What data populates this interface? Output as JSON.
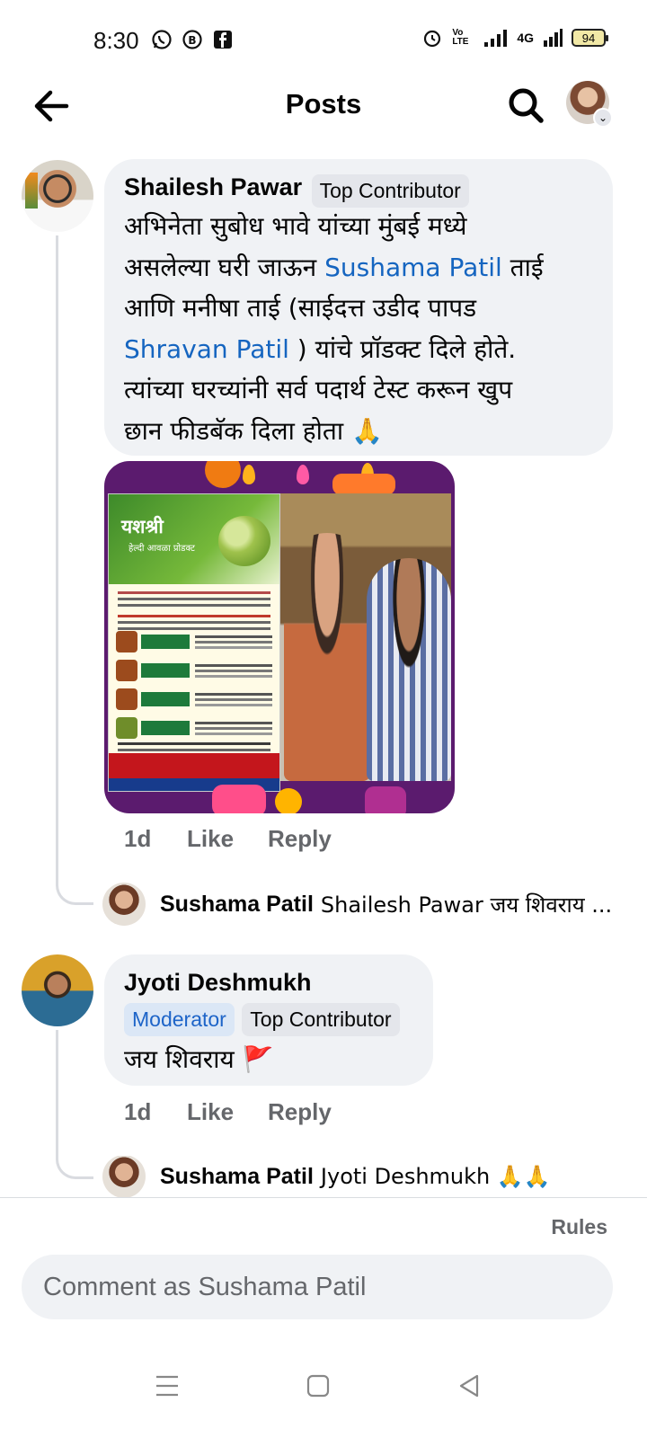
{
  "status_bar": {
    "time": "8:30",
    "network": "4G",
    "volte": "Vo LTE",
    "battery": "94"
  },
  "header": {
    "title": "Posts"
  },
  "comments": [
    {
      "author": "Shailesh Pawar",
      "badges": [
        "Top Contributor"
      ],
      "lines": [
        {
          "segments": [
            {
              "t": "अभिनेता सुबोध भावे यांच्या मुंबई मध्ये"
            }
          ]
        },
        {
          "segments": [
            {
              "t": "असलेल्या घरी जाऊन "
            },
            {
              "t": "Sushama Patil",
              "mention": true
            },
            {
              "t": " ताई"
            }
          ]
        },
        {
          "segments": [
            {
              "t": "आणि मनीषा ताई (साईदत्त उडीद पापड"
            }
          ]
        },
        {
          "segments": [
            {
              "t": "Shravan Patil",
              "mention": true
            },
            {
              "t": " ) यांचे प्रॉडक्ट दिले होते."
            }
          ]
        },
        {
          "segments": [
            {
              "t": "त्यांच्या घरच्यांनी सर्व पदार्थ टेस्ट करून खुप"
            }
          ]
        },
        {
          "segments": [
            {
              "t": "छान फीडबॅक दिला होता 🙏"
            }
          ]
        }
      ],
      "time": "1d",
      "like": "Like",
      "reply": "Reply",
      "image": {
        "flyer_title": "यशश्री",
        "flyer_subtitle": "हेल्दी आवळा प्रोडक्ट"
      },
      "reply_preview": {
        "author": "Sushama Patil",
        "text": "Shailesh Pawar जय शिवराय  ..."
      }
    },
    {
      "author": "Jyoti Deshmukh",
      "badges": [
        "Moderator",
        "Top Contributor"
      ],
      "text": "जय शिवराय 🚩",
      "time": "1d",
      "like": "Like",
      "reply": "Reply",
      "reply_preview": {
        "author": "Sushama Patil",
        "text": "Jyoti Deshmukh 🙏🙏"
      }
    }
  ],
  "composer": {
    "rules": "Rules",
    "placeholder": "Comment as Sushama Patil"
  },
  "icons": {
    "back": "back-arrow-icon",
    "search": "search-icon",
    "menu": "menu-icon",
    "home": "home-icon",
    "back_nav": "back-triangle-icon"
  }
}
